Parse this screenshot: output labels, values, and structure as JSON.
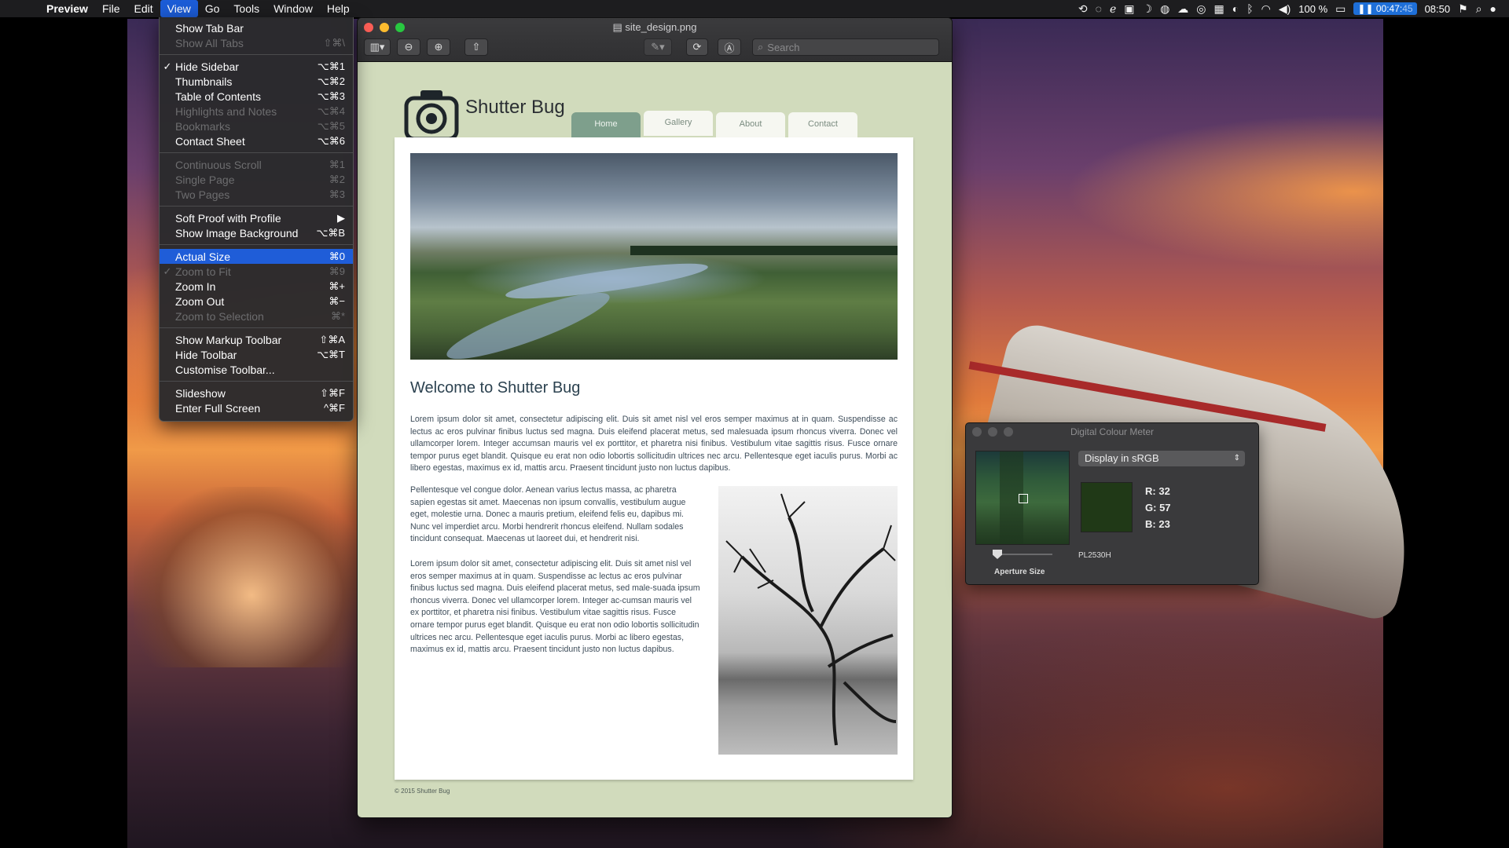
{
  "menubar": {
    "app": "Preview",
    "items": [
      "File",
      "Edit",
      "View",
      "Go",
      "Tools",
      "Window",
      "Help"
    ],
    "active": "View",
    "battery": "100 %",
    "timer": "00:47",
    "timer_seconds": "45",
    "clock": "08:50"
  },
  "view_menu": [
    {
      "label": "Show Tab Bar",
      "shortcut": "",
      "enabled": true
    },
    {
      "label": "Show All Tabs",
      "shortcut": "⇧⌘\\",
      "enabled": false
    },
    {
      "sep": true
    },
    {
      "label": "Hide Sidebar",
      "shortcut": "⌥⌘1",
      "enabled": true,
      "checked": true
    },
    {
      "label": "Thumbnails",
      "shortcut": "⌥⌘2",
      "enabled": true
    },
    {
      "label": "Table of Contents",
      "shortcut": "⌥⌘3",
      "enabled": true
    },
    {
      "label": "Highlights and Notes",
      "shortcut": "⌥⌘4",
      "enabled": false
    },
    {
      "label": "Bookmarks",
      "shortcut": "⌥⌘5",
      "enabled": false
    },
    {
      "label": "Contact Sheet",
      "shortcut": "⌥⌘6",
      "enabled": true
    },
    {
      "sep": true
    },
    {
      "label": "Continuous Scroll",
      "shortcut": "⌘1",
      "enabled": false
    },
    {
      "label": "Single Page",
      "shortcut": "⌘2",
      "enabled": false
    },
    {
      "label": "Two Pages",
      "shortcut": "⌘3",
      "enabled": false
    },
    {
      "sep": true
    },
    {
      "label": "Soft Proof with Profile",
      "shortcut": "▶",
      "enabled": true
    },
    {
      "label": "Show Image Background",
      "shortcut": "⌥⌘B",
      "enabled": true
    },
    {
      "sep": true
    },
    {
      "label": "Actual Size",
      "shortcut": "⌘0",
      "enabled": true,
      "highlighted": true
    },
    {
      "label": "Zoom to Fit",
      "shortcut": "⌘9",
      "enabled": false,
      "checked": true
    },
    {
      "label": "Zoom In",
      "shortcut": "⌘+",
      "enabled": true
    },
    {
      "label": "Zoom Out",
      "shortcut": "⌘−",
      "enabled": true
    },
    {
      "label": "Zoom to Selection",
      "shortcut": "⌘*",
      "enabled": false
    },
    {
      "sep": true
    },
    {
      "label": "Show Markup Toolbar",
      "shortcut": "⇧⌘A",
      "enabled": true
    },
    {
      "label": "Hide Toolbar",
      "shortcut": "⌥⌘T",
      "enabled": true
    },
    {
      "label": "Customise Toolbar...",
      "shortcut": "",
      "enabled": true
    },
    {
      "sep": true
    },
    {
      "label": "Slideshow",
      "shortcut": "⇧⌘F",
      "enabled": true
    },
    {
      "label": "Enter Full Screen",
      "shortcut": "^⌘F",
      "enabled": true
    }
  ],
  "window": {
    "title": "site_design.png",
    "search_placeholder": "Search"
  },
  "site": {
    "brand": "Shutter Bug",
    "tabs": [
      "Home",
      "Gallery",
      "About",
      "Contact"
    ],
    "active_tab": "Home",
    "heading": "Welcome to Shutter Bug",
    "p1": "Lorem ipsum dolor sit amet, consectetur adipiscing elit. Duis sit amet nisl vel eros semper maximus at in quam. Suspendisse ac lectus ac eros pulvinar finibus luctus sed magna. Duis eleifend placerat metus, sed malesuada ipsum rhoncus viverra. Donec vel ullamcorper lorem. Integer accumsan mauris vel ex porttitor, et pharetra nisi finibus. Vestibulum vitae sagittis risus. Fusce ornare tempor purus eget blandit. Quisque eu erat non odio lobortis sollicitudin ultrices nec arcu. Pellentesque eget iaculis purus. Morbi ac libero egestas, maximus ex id, mattis arcu. Praesent tincidunt justo non luctus dapibus.",
    "p2": "Pellentesque vel congue dolor. Aenean varius lectus massa, ac pharetra sapien egestas sit amet. Maecenas non ipsum convallis, vestibulum augue eget, molestie urna. Donec a mauris pretium, eleifend felis eu, dapibus mi. Nunc vel imperdiet arcu. Morbi hendrerit rhoncus eleifend. Nullam sodales tincidunt consequat. Maecenas ut laoreet dui, et hendrerit nisi.",
    "p3": "Lorem ipsum dolor sit amet, consectetur adipiscing elit. Duis sit amet nisl vel eros semper maximus at in quam. Suspendisse ac lectus ac eros pulvinar finibus luctus sed magna. Duis eleifend placerat metus, sed male-suada ipsum rhoncus viverra. Donec vel ullamcorper lorem. Integer ac-cumsan mauris vel ex porttitor, et pharetra nisi finibus. Vestibulum vitae sagittis risus. Fusce ornare tempor purus eget blandit. Quisque eu erat non odio lobortis sollicitudin ultrices nec arcu. Pellentesque eget iaculis purus. Morbi ac libero egestas, maximus ex id, mattis arcu. Praesent tincidunt justo non luctus dapibus.",
    "footer": "© 2015 Shutter Bug"
  },
  "colour_meter": {
    "title": "Digital Colour Meter",
    "mode": "Display in sRGB",
    "r_label": "R:",
    "r": "32",
    "g_label": "G:",
    "g": "57",
    "b_label": "B:",
    "b": "23",
    "display": "PL2530H",
    "aperture_label": "Aperture Size",
    "swatch_color": "#203917"
  }
}
